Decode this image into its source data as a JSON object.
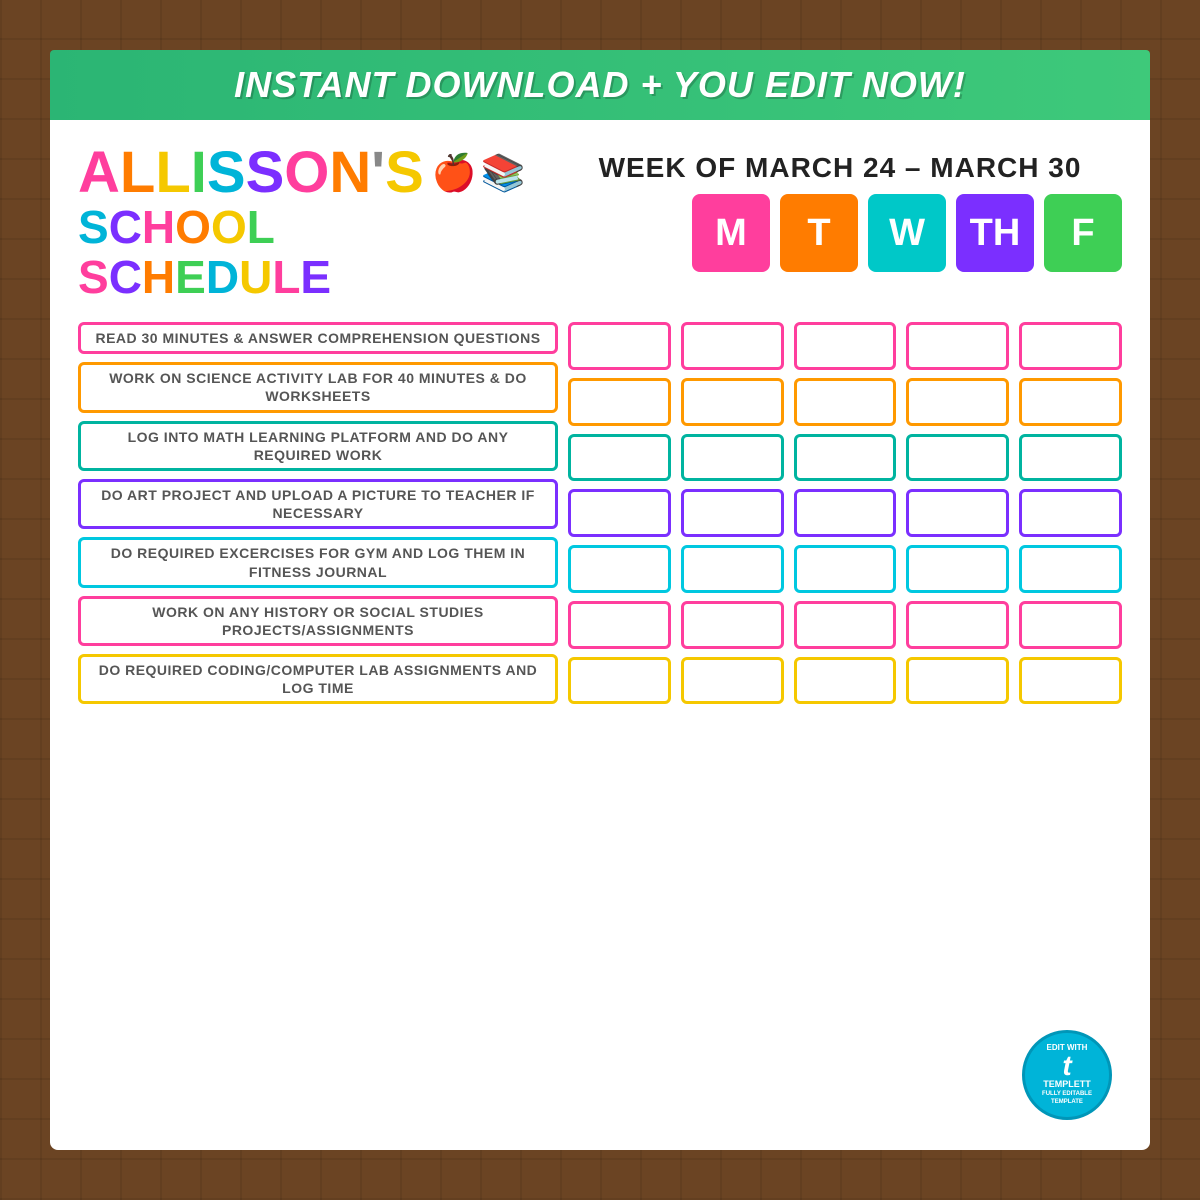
{
  "banner": {
    "text": "INSTANT DOWNLOAD + YOU EDIT NOW!"
  },
  "header": {
    "name": "ALLISON'S",
    "line2": "SCHOOL",
    "line3": "SCHEDULE",
    "week_label": "WEEK OF MARCH 24 – MARCH 30"
  },
  "days": [
    {
      "label": "M",
      "class": "day-m"
    },
    {
      "label": "T",
      "class": "day-t"
    },
    {
      "label": "W",
      "class": "day-w"
    },
    {
      "label": "TH",
      "class": "day-th"
    },
    {
      "label": "F",
      "class": "day-f"
    }
  ],
  "tasks": [
    {
      "text": "READ 30 MINUTES & ANSWER COMPREHENSION QUESTIONS",
      "color": "task-pink",
      "cb_color": "cb-pink"
    },
    {
      "text": "WORK ON SCIENCE ACTIVITY LAB FOR 40 MINUTES & DO WORKSHEETS",
      "color": "task-orange",
      "cb_color": "cb-orange"
    },
    {
      "text": "LOG INTO MATH LEARNING PLATFORM AND DO ANY REQUIRED WORK",
      "color": "task-teal",
      "cb_color": "cb-teal"
    },
    {
      "text": "DO ART PROJECT AND UPLOAD A PICTURE TO TEACHER IF NECESSARY",
      "color": "task-purple",
      "cb_color": "cb-purple"
    },
    {
      "text": "DO REQUIRED EXCERCISES FOR GYM AND LOG THEM IN FITNESS JOURNAL",
      "color": "task-cyan",
      "cb_color": "cb-cyan"
    },
    {
      "text": "WORK ON ANY HISTORY OR SOCIAL STUDIES PROJECTS/ASSIGNMENTS",
      "color": "task-hotpink",
      "cb_color": "cb-hotpink"
    },
    {
      "text": "DO REQUIRED CODING/COMPUTER LAB ASSIGNMENTS AND LOG TIME",
      "color": "task-gold",
      "cb_color": "cb-gold"
    }
  ],
  "templett": {
    "line1": "EDIT WITH",
    "brand": "t",
    "line2": "templett",
    "line3": "FULLY EDITABLE TEMPLATE"
  }
}
